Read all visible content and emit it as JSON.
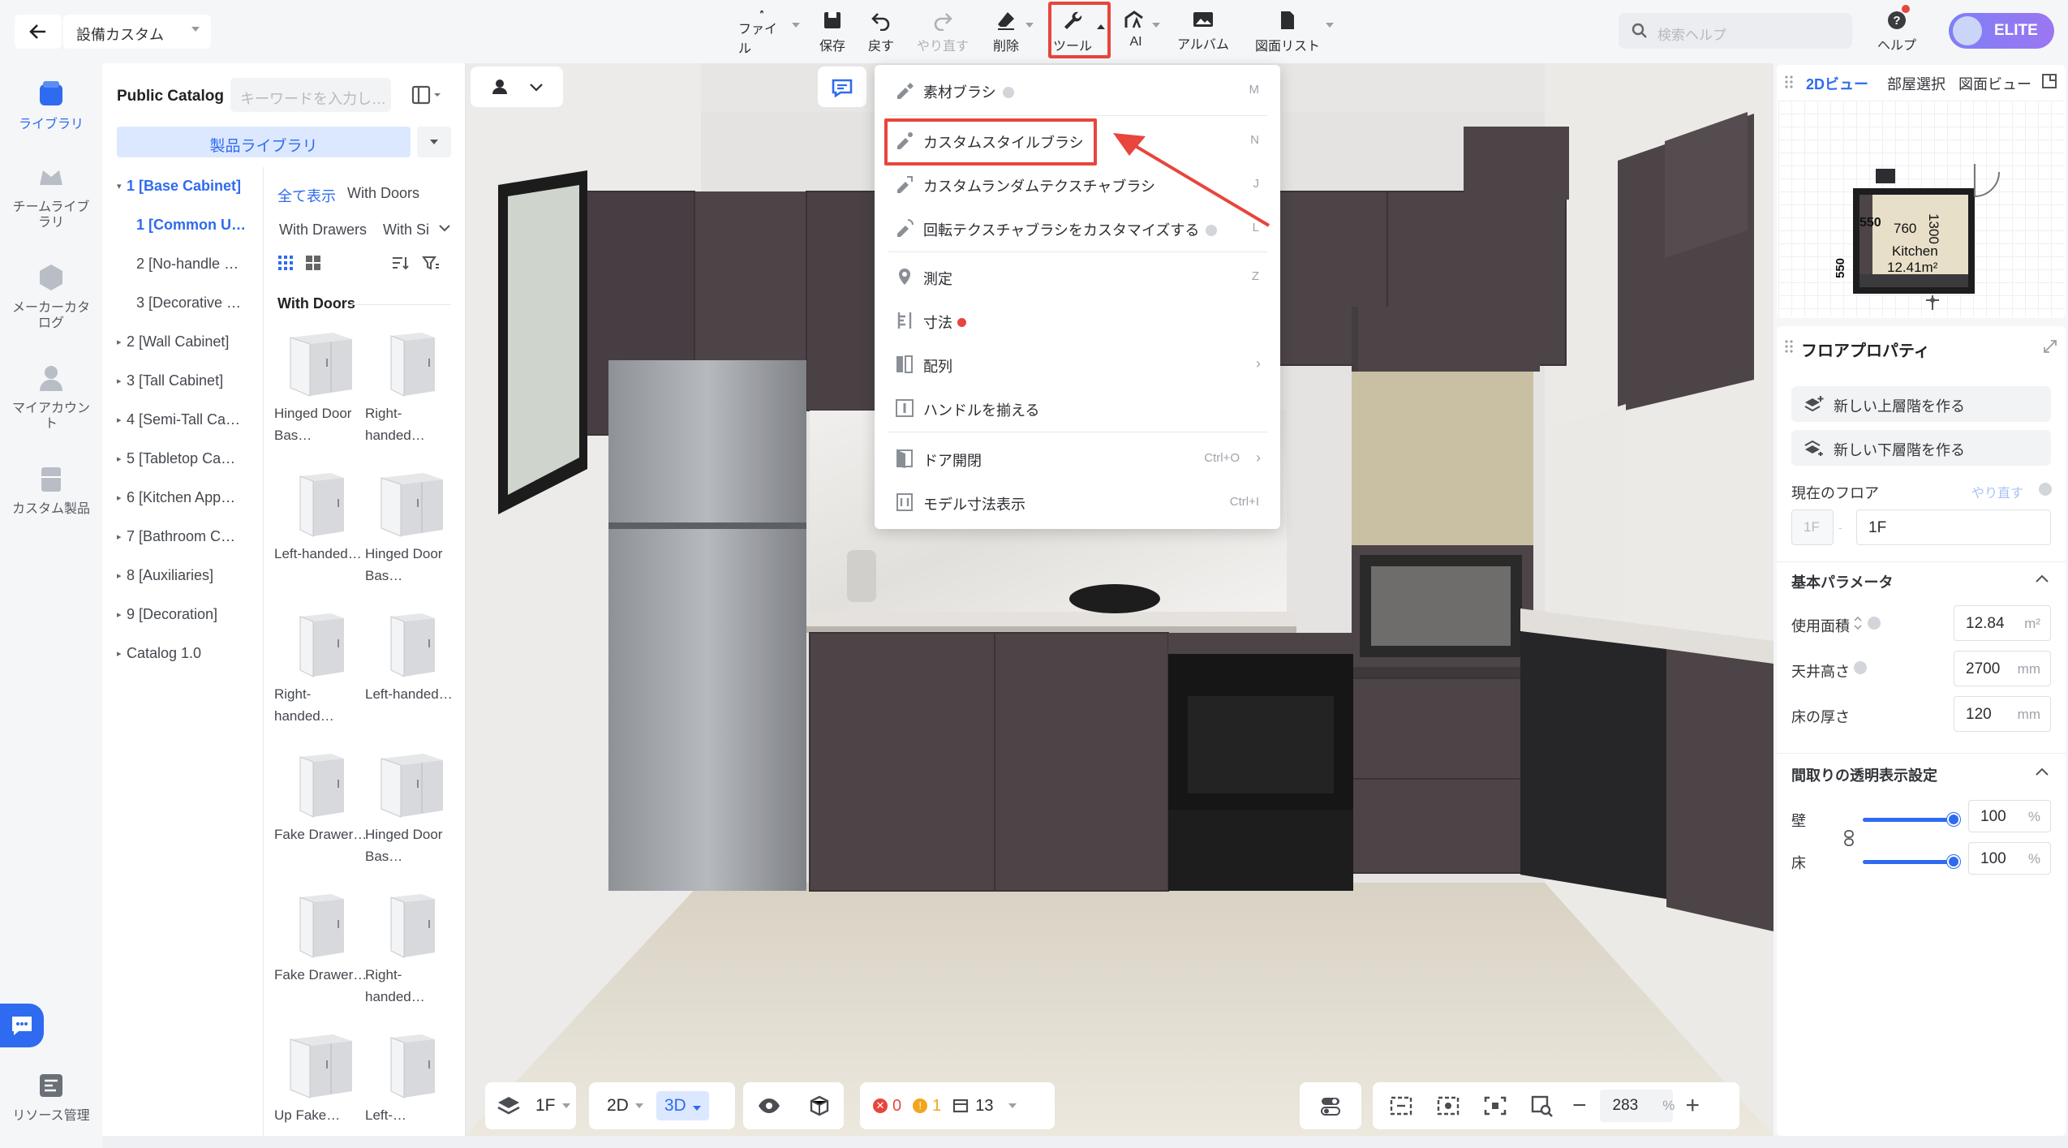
{
  "topbar": {
    "back_icon": "arrow-left-icon",
    "design_name": "設備カスタム",
    "buttons": [
      {
        "label": "ファイル",
        "icon": "file-icon"
      },
      {
        "label": "保存",
        "icon": "save-icon"
      },
      {
        "label": "戻す",
        "icon": "undo-icon"
      },
      {
        "label": "やり直す",
        "icon": "redo-icon"
      },
      {
        "label": "削除",
        "icon": "eraser-icon"
      },
      {
        "label": "ツール",
        "icon": "wrench-icon"
      },
      {
        "label": "AI",
        "icon": "ai-icon"
      },
      {
        "label": "アルバム",
        "icon": "album-icon"
      },
      {
        "label": "図面リスト",
        "icon": "drawing-list-icon"
      }
    ],
    "help_search_placeholder": "検索ヘルプ",
    "help_label": "ヘルプ",
    "elite_label": "ELITE"
  },
  "left_rail": {
    "items": [
      {
        "label": "ライブラリ",
        "icon": "library-icon"
      },
      {
        "label": "チームライブラリ",
        "icon": "team-library-icon"
      },
      {
        "label": "メーカーカタログ",
        "icon": "maker-catalog-icon"
      },
      {
        "label": "マイアカウント",
        "icon": "my-account-icon"
      },
      {
        "label": "カスタム製品",
        "icon": "custom-product-icon"
      }
    ],
    "resource_label": "リソース管理"
  },
  "catalog": {
    "title": "Public Catalog",
    "search_placeholder": "キーワードを入力し…",
    "product_library": "製品ライブラリ",
    "tree": [
      "1 [Base Cabinet]",
      "1 [Common U…",
      "2 [No-handle …",
      "3 [Decorative …",
      "2 [Wall Cabinet]",
      "3 [Tall Cabinet]",
      "4 [Semi-Tall Ca…",
      "5 [Tabletop Ca…",
      "6 [Kitchen App…",
      "7 [Bathroom C…",
      "8 [Auxiliaries]",
      "9 [Decoration]",
      "Catalog 1.0"
    ],
    "filters": {
      "show_all": "全て表示",
      "with_doors": "With Doors",
      "with_drawers": "With Drawers",
      "with_si": "With Si"
    },
    "section_title": "With Doors",
    "products": [
      "Hinged Door Bas…",
      "Right-handed…",
      "Left-handed…",
      "Hinged Door Bas…",
      "Right-handed…",
      "Left-handed…",
      "Fake Drawer…",
      "Hinged Door Bas…",
      "Fake Drawer…",
      "Right-handed…",
      "Up Fake…",
      "Left-…"
    ]
  },
  "tool_menu": {
    "items": [
      {
        "label": "素材ブラシ",
        "shortcut": "M",
        "icon": "material-brush-icon"
      },
      {
        "label": "カスタムスタイルブラシ",
        "shortcut": "N",
        "icon": "style-brush-icon"
      },
      {
        "label": "カスタムランダムテクスチャブラシ",
        "shortcut": "J",
        "icon": "random-texture-brush-icon"
      },
      {
        "label": "回転テクスチャブラシをカスタマイズする",
        "shortcut": "L",
        "icon": "rotate-texture-brush-icon"
      },
      {
        "label": "測定",
        "shortcut": "Z",
        "icon": "measure-icon"
      },
      {
        "label": "寸法",
        "shortcut": "",
        "icon": "dimension-icon"
      },
      {
        "label": "配列",
        "shortcut": "",
        "icon": "array-icon"
      },
      {
        "label": "ハンドルを揃える",
        "shortcut": "",
        "icon": "align-handle-icon"
      },
      {
        "label": "ドア開閉",
        "shortcut": "Ctrl+O",
        "icon": "door-open-icon"
      },
      {
        "label": "モデル寸法表示",
        "shortcut": "Ctrl+I",
        "icon": "model-dimension-icon"
      }
    ]
  },
  "bottom_bar": {
    "floor": "1F",
    "view2d": "2D",
    "view3d": "3D",
    "errors": "0",
    "warnings": "1",
    "items_count": "13",
    "zoom": "283",
    "zoom_unit": "%"
  },
  "right_panel": {
    "tabs": [
      "2Dビュー",
      "部屋選択",
      "図面ビュー"
    ],
    "minimap": {
      "dim_top": "760",
      "dim_left1": "550",
      "dim_left2": "550",
      "dim_right": "1300",
      "room_name": "Kitchen",
      "room_area": "12.41m²"
    },
    "floor_props": {
      "title": "フロアプロパティ",
      "add_upper": "新しい上層階を作る",
      "add_lower": "新しい下層階を作る",
      "current_floor_label": "現在のフロア",
      "redo_label": "やり直す",
      "floor_code": "1F",
      "floor_name": "1F",
      "basic_params": "基本パラメータ",
      "area_label": "使用面積",
      "area_value": "12.84",
      "area_unit": "m²",
      "ceiling_label": "天井高さ",
      "ceiling_value": "2700",
      "ceiling_unit": "mm",
      "floor_thick_label": "床の厚さ",
      "floor_thick_value": "120",
      "floor_thick_unit": "mm",
      "transparency_title": "間取りの透明表示設定",
      "wall_label": "壁",
      "wall_value": "100",
      "floor_label": "床",
      "floor_value": "100",
      "percent": "%"
    }
  },
  "colors": {
    "accent": "#2f6bf0",
    "highlight": "#e8453c",
    "cabinet": "#4d4448"
  }
}
